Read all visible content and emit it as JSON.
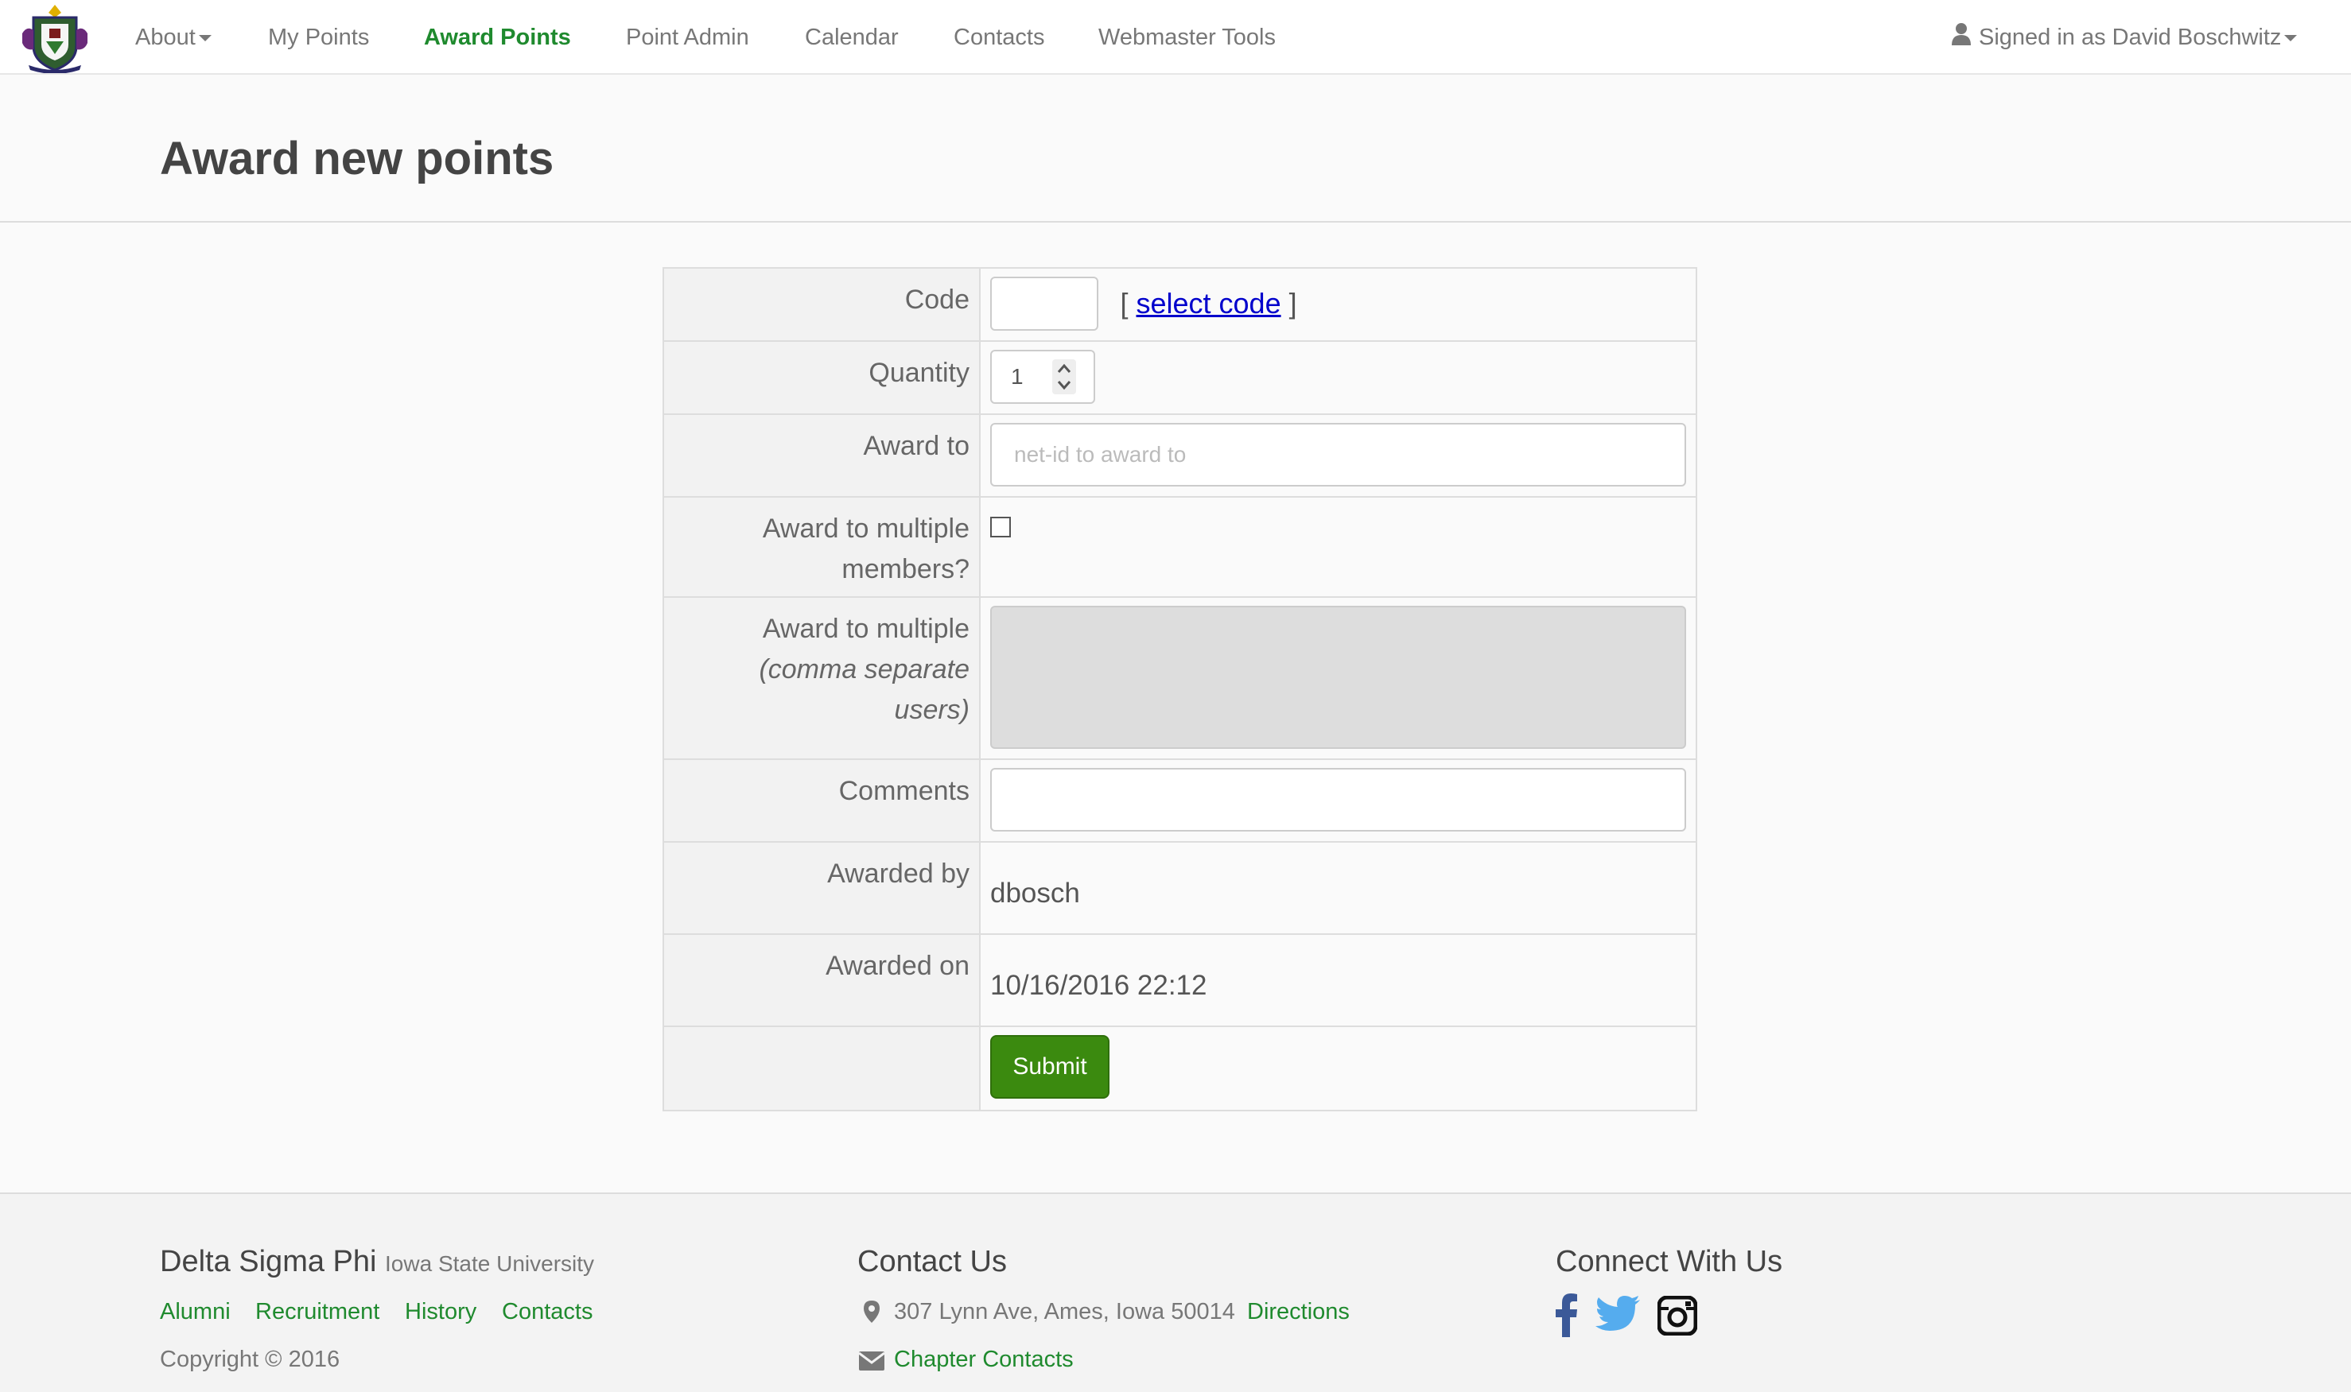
{
  "nav": {
    "items": [
      {
        "label": "About",
        "has_caret": true
      },
      {
        "label": "My Points"
      },
      {
        "label": "Award Points",
        "active": true
      },
      {
        "label": "Point Admin"
      },
      {
        "label": "Calendar"
      },
      {
        "label": "Contacts"
      },
      {
        "label": "Webmaster Tools"
      }
    ],
    "user": "Signed in as David Boschwitz"
  },
  "page": {
    "title": "Award new points"
  },
  "form": {
    "code_label": "Code",
    "code_value": "",
    "select_code_open": "[",
    "select_code_link": "select code",
    "select_code_close": "]",
    "quantity_label": "Quantity",
    "quantity_value": "1",
    "award_to_label": "Award to",
    "award_to_placeholder": "net-id to award to",
    "multiple_label_1": "Award to multiple",
    "multiple_label_2": "members?",
    "multiple_checked": false,
    "multi_users_label_1": "Award to multiple",
    "multi_users_label_2": "(comma separate",
    "multi_users_label_3": "users)",
    "comments_label": "Comments",
    "comments_value": "",
    "awarded_by_label": "Awarded by",
    "awarded_by_value": "dbosch",
    "awarded_on_label": "Awarded on",
    "awarded_on_value": "10/16/2016 22:12",
    "submit_label": "Submit"
  },
  "footer": {
    "org_name": "Delta Sigma Phi",
    "org_school": "Iowa State University",
    "links": [
      "Alumni",
      "Recruitment",
      "History",
      "Contacts"
    ],
    "copyright": "Copyright © 2016",
    "contact_heading": "Contact Us",
    "address": "307 Lynn Ave, Ames, Iowa 50014",
    "directions": "Directions",
    "chapter_contacts": "Chapter Contacts",
    "connect_heading": "Connect With Us",
    "social_icons": [
      "facebook-icon",
      "twitter-icon",
      "instagram-icon"
    ]
  },
  "colors": {
    "accent_green": "#1f8a2e",
    "submit_green": "#3b8a0f",
    "link_blue": "#0000cc"
  }
}
